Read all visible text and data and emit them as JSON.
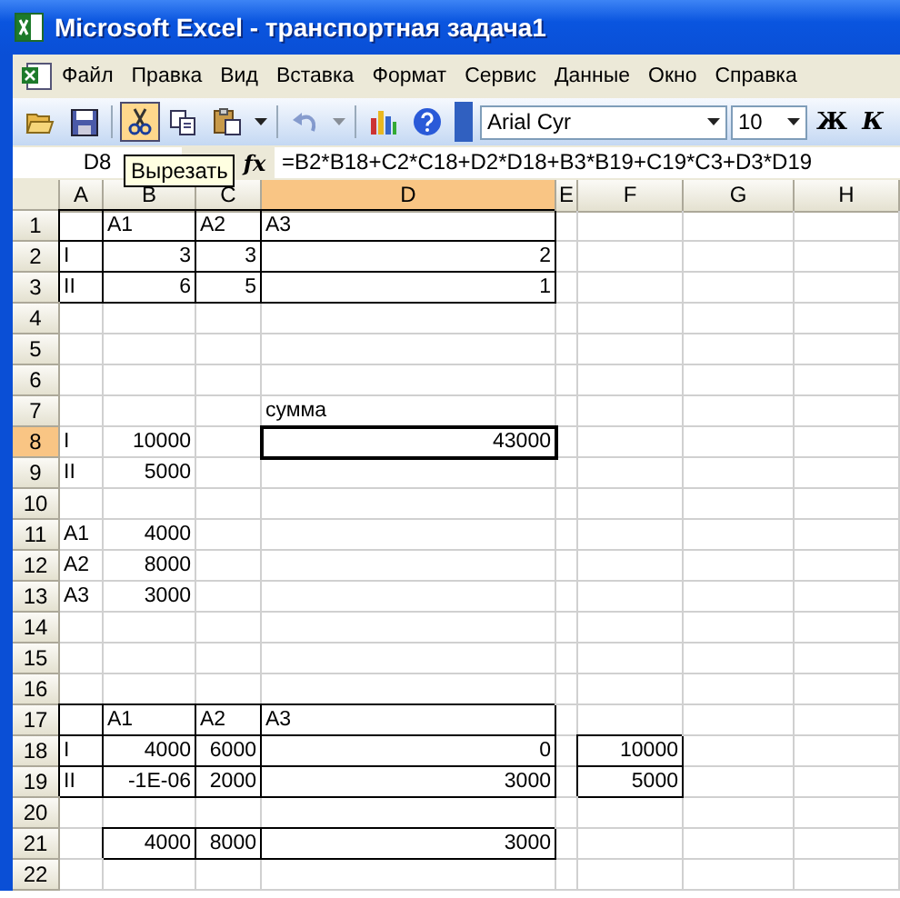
{
  "window": {
    "title": "Microsoft Excel - транспортная задача1"
  },
  "menu": [
    "Файл",
    "Правка",
    "Вид",
    "Вставка",
    "Формат",
    "Сервис",
    "Данные",
    "Окно",
    "Справка"
  ],
  "toolbar": {
    "buttons": [
      {
        "kind": "open",
        "pressed": false,
        "disabled": false
      },
      {
        "kind": "save",
        "pressed": false,
        "disabled": false
      },
      {
        "kind": "sep"
      },
      {
        "kind": "cut",
        "pressed": true,
        "disabled": false
      },
      {
        "kind": "copy",
        "pressed": false,
        "disabled": false
      },
      {
        "kind": "paste",
        "pressed": false,
        "disabled": false
      },
      {
        "kind": "dropdown",
        "pressed": false,
        "disabled": false
      },
      {
        "kind": "sep"
      },
      {
        "kind": "undo",
        "pressed": false,
        "disabled": true
      },
      {
        "kind": "dropdown",
        "pressed": false,
        "disabled": true
      },
      {
        "kind": "sep"
      },
      {
        "kind": "chart",
        "pressed": false,
        "disabled": false
      },
      {
        "kind": "help",
        "pressed": false,
        "disabled": false
      }
    ],
    "font": "Arial Cyr",
    "size": "10",
    "bold": "Ж",
    "italic": "К"
  },
  "tooltip": "Вырезать",
  "formula_bar": {
    "name_box": "D8",
    "fx": "fx",
    "formula": "=B2*B18+C2*C18+D2*D18+B3*B19+C19*C3+D3*D19"
  },
  "columns": [
    {
      "label": "A",
      "selected": false
    },
    {
      "label": "B",
      "selected": false
    },
    {
      "label": "C",
      "selected": false
    },
    {
      "label": "D",
      "selected": true
    },
    {
      "label": "E",
      "selected": false
    },
    {
      "label": "F",
      "selected": false
    },
    {
      "label": "G",
      "selected": false
    },
    {
      "label": "H",
      "selected": false
    }
  ],
  "rows": [
    {
      "label": "1",
      "selected": false,
      "cells": [
        {
          "bordered": true
        },
        {
          "text": "A1",
          "bordered": true
        },
        {
          "text": "A2",
          "bordered": true
        },
        {
          "text": "A3",
          "bordered": true
        }
      ]
    },
    {
      "label": "2",
      "selected": false,
      "cells": [
        {
          "text": "I",
          "bordered": true
        },
        {
          "text": "3",
          "kind": "number",
          "bordered": true
        },
        {
          "text": "3",
          "kind": "number",
          "bordered": true
        },
        {
          "text": "2",
          "kind": "number",
          "bordered": true
        }
      ]
    },
    {
      "label": "3",
      "selected": false,
      "cells": [
        {
          "text": "II",
          "bordered": true
        },
        {
          "text": "6",
          "kind": "number",
          "bordered": true
        },
        {
          "text": "5",
          "kind": "number",
          "bordered": true
        },
        {
          "text": "1",
          "kind": "number",
          "bordered": true
        }
      ]
    },
    {
      "label": "4",
      "selected": false
    },
    {
      "label": "5",
      "selected": false
    },
    {
      "label": "6",
      "selected": false
    },
    {
      "label": "7",
      "selected": false,
      "cells": [
        {
          "bordered": false
        },
        {
          "bordered": false
        },
        {
          "bordered": false
        },
        {
          "text": "сумма",
          "bordered": false
        }
      ]
    },
    {
      "label": "8",
      "selected": true,
      "cells": [
        {
          "text": "I",
          "bordered": false
        },
        {
          "text": "10000",
          "kind": "number",
          "bordered": false
        },
        {
          "bordered": false
        },
        {
          "text": "43000",
          "kind": "number",
          "bordered": false,
          "selected": true
        }
      ]
    },
    {
      "label": "9",
      "selected": false,
      "cells": [
        {
          "text": "II",
          "bordered": false
        },
        {
          "text": "5000",
          "kind": "number",
          "bordered": false
        }
      ]
    },
    {
      "label": "10",
      "selected": false
    },
    {
      "label": "11",
      "selected": false,
      "cells": [
        {
          "text": "A1",
          "bordered": false
        },
        {
          "text": "4000",
          "kind": "number",
          "bordered": false
        }
      ]
    },
    {
      "label": "12",
      "selected": false,
      "cells": [
        {
          "text": "A2",
          "bordered": false
        },
        {
          "text": "8000",
          "kind": "number",
          "bordered": false
        }
      ]
    },
    {
      "label": "13",
      "selected": false,
      "cells": [
        {
          "text": "A3",
          "bordered": false
        },
        {
          "text": "3000",
          "kind": "number",
          "bordered": false
        }
      ]
    },
    {
      "label": "14",
      "selected": false
    },
    {
      "label": "15",
      "selected": false
    },
    {
      "label": "16",
      "selected": false
    },
    {
      "label": "17",
      "selected": false,
      "cells": [
        {
          "bordered": true
        },
        {
          "text": "A1",
          "bordered": true
        },
        {
          "text": "A2",
          "bordered": true
        },
        {
          "text": "A3",
          "bordered": true
        }
      ]
    },
    {
      "label": "18",
      "selected": false,
      "cells": [
        {
          "text": "I",
          "bordered": true
        },
        {
          "text": "4000",
          "kind": "number",
          "bordered": true
        },
        {
          "text": "6000",
          "kind": "number",
          "bordered": true
        },
        {
          "text": "0",
          "kind": "number",
          "bordered": true
        },
        {
          "bordered": false
        },
        {
          "text": "10000",
          "kind": "number",
          "bordered": true
        }
      ]
    },
    {
      "label": "19",
      "selected": false,
      "cells": [
        {
          "text": "II",
          "bordered": true
        },
        {
          "text": "-1E-06",
          "kind": "number",
          "bordered": true
        },
        {
          "text": "2000",
          "kind": "number",
          "bordered": true
        },
        {
          "text": "3000",
          "kind": "number",
          "bordered": true
        },
        {
          "bordered": false
        },
        {
          "text": "5000",
          "kind": "number",
          "bordered": true
        }
      ]
    },
    {
      "label": "20",
      "selected": false
    },
    {
      "label": "21",
      "selected": false,
      "cells": [
        {
          "bordered": false
        },
        {
          "text": "4000",
          "kind": "number",
          "bordered": true
        },
        {
          "text": "8000",
          "kind": "number",
          "bordered": true
        },
        {
          "text": "3000",
          "kind": "number",
          "bordered": true
        }
      ]
    },
    {
      "label": "22",
      "selected": false
    }
  ]
}
